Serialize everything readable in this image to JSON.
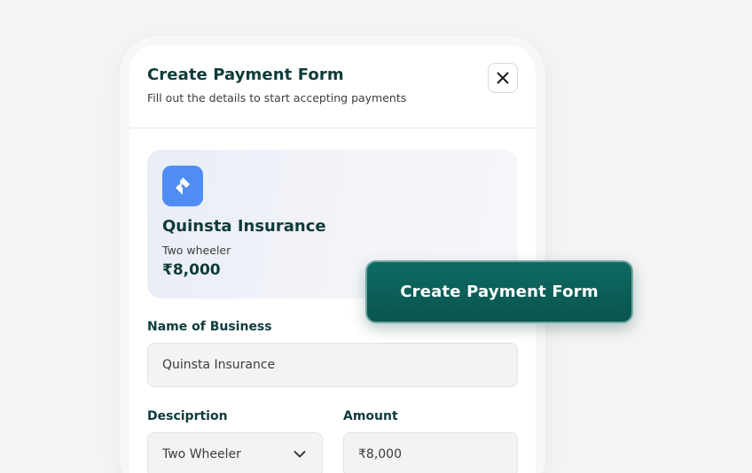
{
  "modal": {
    "title": "Create Payment Form",
    "subtitle": "Fill out the details to start accepting payments",
    "close_icon": "close-icon"
  },
  "summary": {
    "logo_icon": "quinsta-logo-icon",
    "logo_color": "#4f8df5",
    "business_name": "Quinsta Insurance",
    "description": "Two wheeler",
    "amount": "₹8,000"
  },
  "form": {
    "business_label": "Name of Business",
    "business_value": "Quinsta Insurance",
    "description_label": "Desciprtion",
    "description_value": "Two Wheeler",
    "amount_label": "Amount",
    "amount_value": "₹8,000"
  },
  "cta": {
    "label": "Create Payment Form",
    "color": "#0d6b63"
  }
}
